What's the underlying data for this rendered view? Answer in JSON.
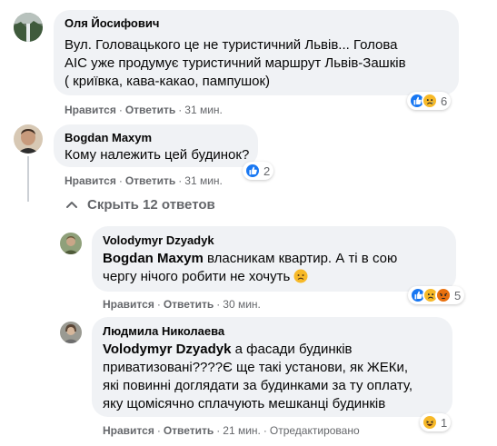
{
  "comments": [
    {
      "author": "Оля Йосифович",
      "text": [
        "Вул. Головацького це не туристичний Львів... Голова",
        "АІС уже продумує туристичний маршрут Львів-Зашків",
        "( криївка, кава-какао, пампушок)"
      ],
      "like": "Нравится",
      "reply": "Ответить",
      "time": "31 мин.",
      "reaction_count": "6",
      "reactions": [
        "like-icon",
        "sad-icon"
      ]
    },
    {
      "author": "Bogdan Maxym",
      "text": "Кому належить цей будинок?",
      "like": "Нравится",
      "reply": "Ответить",
      "time": "31 мин.",
      "reaction_count": "2",
      "reactions": [
        "like-icon"
      ]
    }
  ],
  "hide_replies_label": "Скрыть 12 ответов",
  "replies": [
    {
      "author": "Volodymyr Dzyadyk",
      "mention": "Bogdan Maxym",
      "text_line1": " власникам квартир. А ті в сою",
      "text_line2": "чергу нічого робити не хочуть",
      "inline_emoji": "sad-face-icon",
      "like": "Нравится",
      "reply": "Ответить",
      "time": "30 мин.",
      "reaction_count": "5",
      "reactions": [
        "like-icon",
        "sad-icon",
        "angry-icon"
      ]
    },
    {
      "author": "Людмила Николаева",
      "mention": "Volodymyr Dzyadyk",
      "text_line1": " а фасади будинків",
      "text_rest": [
        "приватизовані????Є ще такі установи, як ЖЕКи,",
        "які повинні доглядати за будинками за ту оплату,",
        "яку щомісячно сплачують мешканці будинків"
      ],
      "like": "Нравится",
      "reply": "Ответить",
      "time": "21 мин.",
      "edited": "Отредактировано",
      "reaction_count": "1",
      "reactions": [
        "haha-icon"
      ]
    }
  ],
  "colors": {
    "bubble": "#f0f2f5",
    "like_blue": "#1877f2",
    "reaction_yellow": "#f7b928",
    "angry_orange": "#e9710f",
    "secondary_text": "#65676b"
  }
}
